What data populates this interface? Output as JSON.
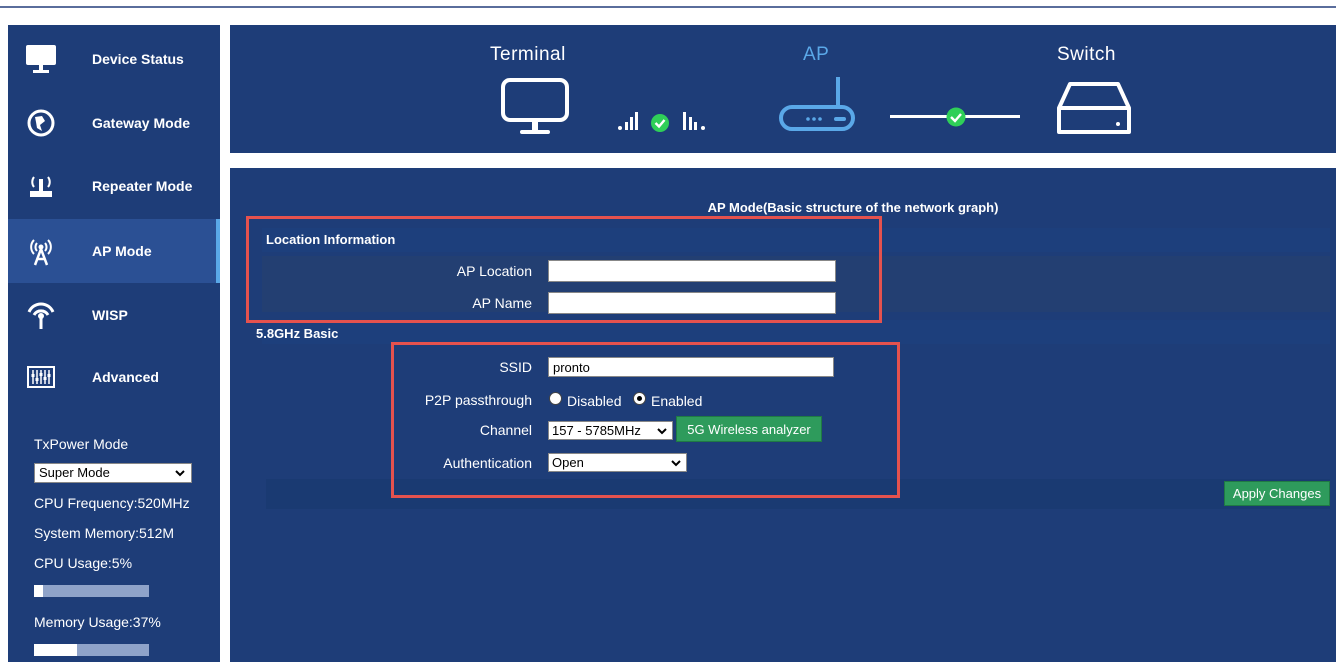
{
  "sidebar": {
    "items": [
      {
        "label": "Device Status",
        "icon": "monitor-icon"
      },
      {
        "label": "Gateway Mode",
        "icon": "globe-icon"
      },
      {
        "label": "Repeater Mode",
        "icon": "repeater-icon"
      },
      {
        "label": "AP Mode",
        "icon": "ap-antenna-icon"
      },
      {
        "label": "WISP",
        "icon": "wisp-icon"
      },
      {
        "label": "Advanced",
        "icon": "equalizer-icon"
      }
    ],
    "active_index": 3,
    "txpower_label": "TxPower Mode",
    "txpower_value": "Super Mode",
    "cpu_frequency": "CPU Frequency:520MHz",
    "system_memory": "System Memory:512M",
    "cpu_usage": "CPU Usage:5%",
    "cpu_usage_fraction": 0.05,
    "memory_usage": "Memory Usage:37%",
    "memory_usage_fraction": 0.37
  },
  "banner": {
    "terminal": "Terminal",
    "ap": "AP",
    "switch": "Switch"
  },
  "main": {
    "title": "AP Mode(Basic structure of the network graph)",
    "location_section": "Location Information",
    "ap_location_label": "AP Location",
    "ap_location_value": "",
    "ap_name_label": "AP Name",
    "ap_name_value": "",
    "basic_section": "5.8GHz Basic",
    "ssid_label": "SSID",
    "ssid_value": "pronto",
    "p2p_label": "P2P passthrough",
    "p2p_disabled": "Disabled",
    "p2p_enabled": "Enabled",
    "p2p_selected": "Enabled",
    "channel_label": "Channel",
    "channel_value": "157 - 5785MHz",
    "analyzer_button": "5G Wireless analyzer",
    "auth_label": "Authentication",
    "auth_value": "Open",
    "apply_button": "Apply Changes"
  },
  "colors": {
    "panel": "#1e3d78",
    "accent": "#5aa8e8",
    "button": "#2e9b5c",
    "highlight": "#e5524e"
  }
}
